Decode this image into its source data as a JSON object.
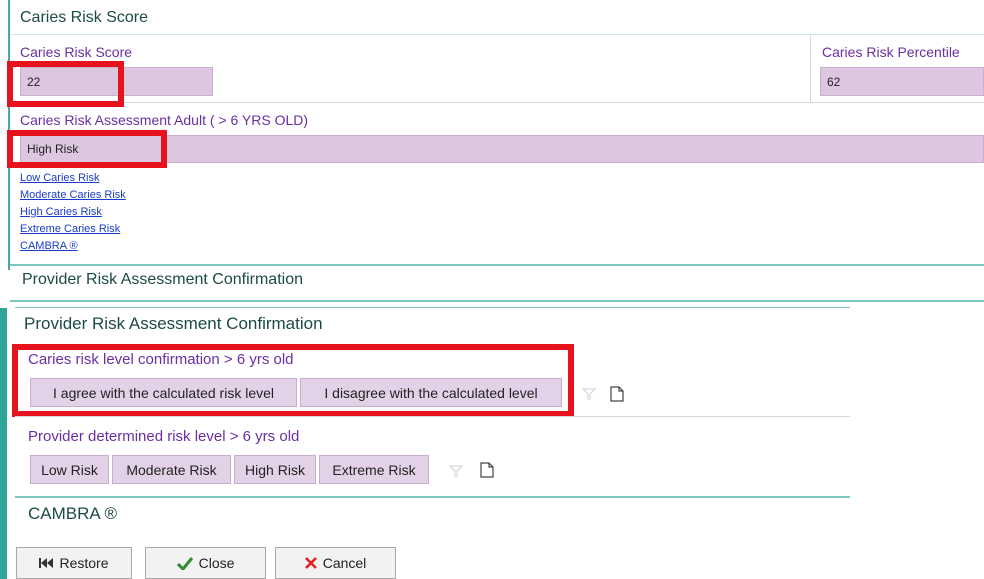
{
  "score_section": {
    "title": "Caries Risk Score",
    "score_label": "Caries Risk Score",
    "score_value": "22",
    "percentile_label": "Caries Risk Percentile",
    "percentile_value": "62"
  },
  "assessment": {
    "label": "Caries Risk Assessment Adult ( > 6 YRS OLD)",
    "value": "High Risk",
    "links": [
      "Low Caries Risk",
      "Moderate Caries Risk",
      "High Caries Risk",
      "Extreme Caries Risk",
      "CAMBRA ®"
    ]
  },
  "provider_header": {
    "title": "Provider Risk Assessment Confirmation"
  },
  "provider_panel": {
    "title": "Provider Risk Assessment Confirmation",
    "confirmation": {
      "label": "Caries risk level confirmation > 6 yrs old",
      "options": [
        "I agree with the calculated risk level",
        "I disagree with the calculated level"
      ]
    },
    "determined": {
      "label": "Provider determined risk level > 6 yrs old",
      "options": [
        "Low Risk",
        "Moderate Risk",
        "High Risk",
        "Extreme Risk"
      ]
    },
    "cambra_title": "CAMBRA ®"
  },
  "footer": {
    "restore_label": "Restore",
    "close_label": "Close",
    "cancel_label": "Cancel"
  },
  "colors": {
    "field_bg": "#dcc6e0",
    "highlight_red": "#e6121d",
    "teal": "#4aa8a0",
    "label_purple": "#6b2fa3"
  }
}
